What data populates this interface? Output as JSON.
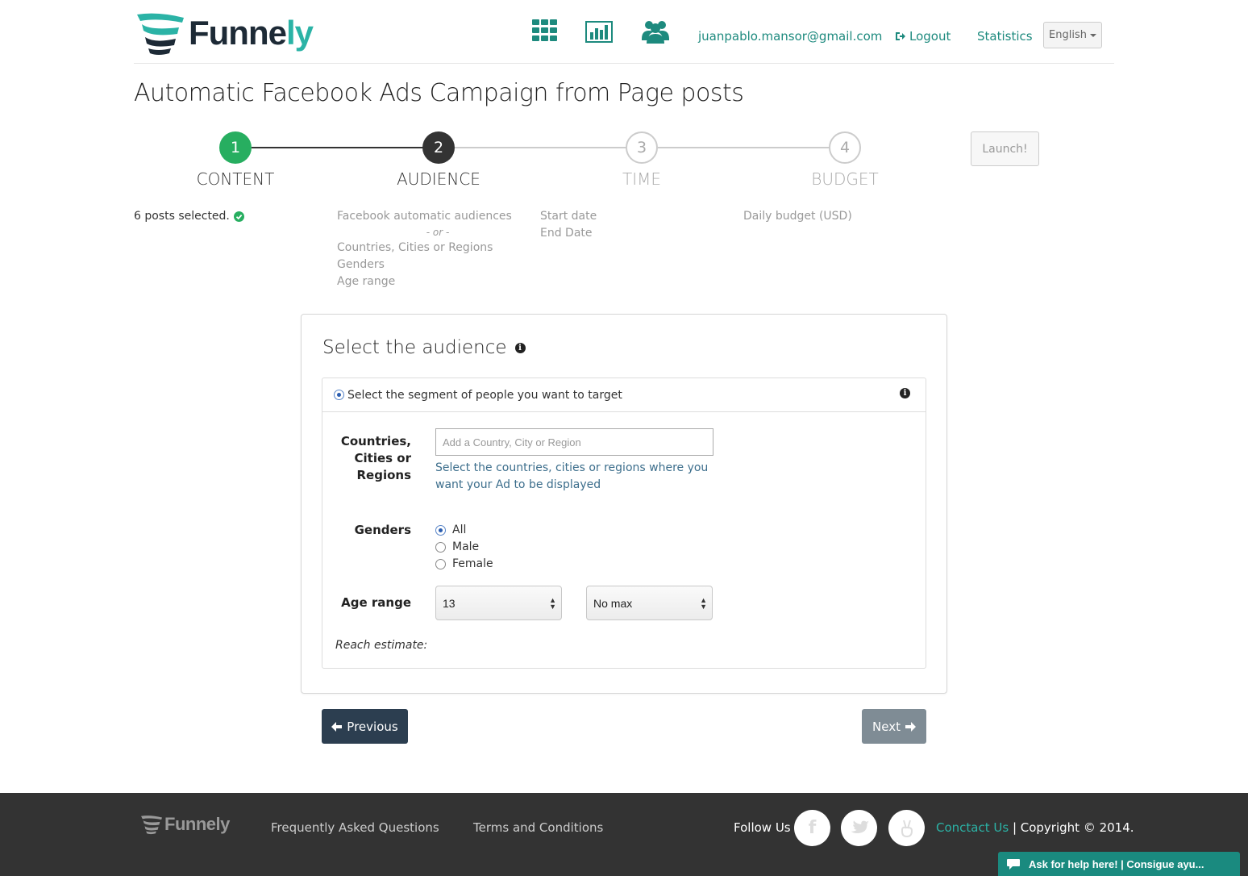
{
  "header": {
    "logo_text_main": "Funne",
    "logo_text_accent": "ly",
    "email": "juanpablo.mansor@gmail.com",
    "logout": "Logout",
    "statistics": "Statistics",
    "language": "English"
  },
  "page_title": "Automatic Facebook Ads Campaign from Page posts",
  "steps": [
    {
      "number": "1",
      "label": "CONTENT"
    },
    {
      "number": "2",
      "label": "AUDIENCE"
    },
    {
      "number": "3",
      "label": "TIME"
    },
    {
      "number": "4",
      "label": "BUDGET"
    }
  ],
  "launch": "Launch!",
  "summary": {
    "content": "6 posts selected.",
    "audience_1": "Facebook automatic audiences",
    "audience_or": "- or -",
    "audience_2": "Countries, Cities or Regions",
    "audience_3": "Genders",
    "audience_4": "Age range",
    "time_1": "Start date",
    "time_2": "End Date",
    "budget_1": "Daily budget (USD)"
  },
  "panel": {
    "title": "Select the audience",
    "segment_label": "Select the segment of people you want to target",
    "location_label": "Countries, Cities or Regions",
    "location_placeholder": "Add a Country, City or Region",
    "location_help": "Select the countries, cities or regions where you want your Ad to be displayed",
    "genders_label": "Genders",
    "gender_options": [
      "All",
      "Male",
      "Female"
    ],
    "gender_selected": "All",
    "age_label": "Age range",
    "age_min": "13",
    "age_max": "No max",
    "reach": "Reach estimate:"
  },
  "buttons": {
    "previous": "Previous",
    "next": "Next"
  },
  "footer": {
    "logo_text": "Funnely",
    "faq": "Frequently Asked Questions",
    "terms": "Terms and Conditions",
    "follow": "Follow Us",
    "contact": "Conctact Us",
    "copyright": " | Copyright © 2014.",
    "help_chat": "Ask for help here! | Consigue ayu..."
  },
  "colors": {
    "accent": "#2bb3a6",
    "step_done": "#27ae60",
    "step_active": "#333333",
    "footer_bg": "#333333",
    "primary_button": "#2c3e50"
  }
}
